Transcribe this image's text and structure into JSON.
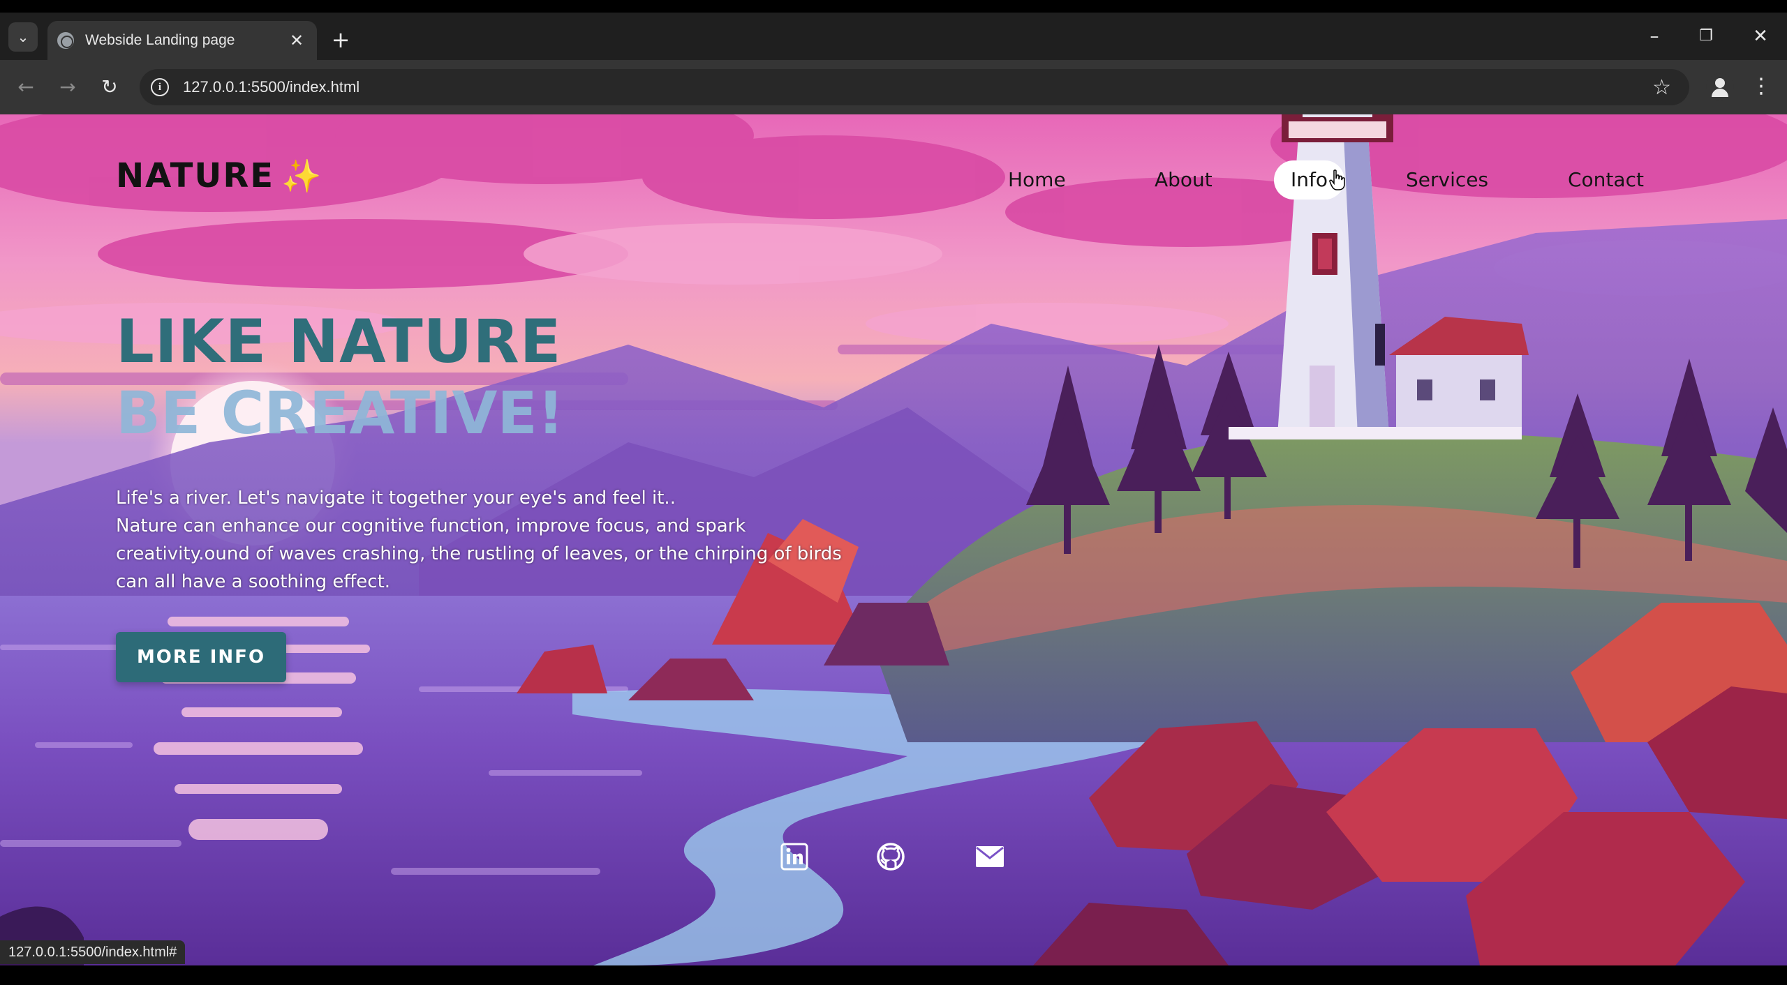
{
  "browser": {
    "tab_title": "Webside Landing page",
    "url": "127.0.0.1:5500/index.html",
    "status_url": "127.0.0.1:5500/index.html#"
  },
  "site": {
    "brand": "NATURE",
    "brand_emoji": "✨",
    "nav": [
      "Home",
      "About",
      "Info",
      "Services",
      "Contact"
    ],
    "active_nav": "Info",
    "hero_title": "LIKE NATURE",
    "hero_subtitle": "BE CREATIVE!",
    "hero_text": [
      "Life's a river. Let's navigate it together your eye's and feel it..",
      "Nature can enhance our cognitive function, improve focus, and spark",
      "creativity.ound of waves crashing, the rustling of leaves, or the chirping of birds",
      "can all have a soothing effect."
    ],
    "cta": "MORE INFO",
    "social_icons": [
      "linkedin-icon",
      "github-icon",
      "mail-icon"
    ]
  },
  "colors": {
    "accent": "#2d6b78",
    "title": "#2f6e7a",
    "subtitle": "#8fb7d8",
    "sky_pink": "#ee7fbd",
    "water_purple": "#7a52c6"
  }
}
